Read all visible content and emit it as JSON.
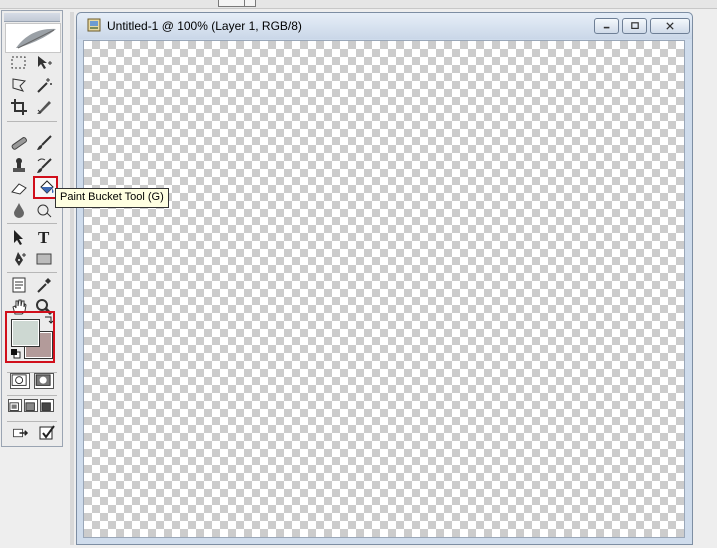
{
  "document": {
    "title": "Untitled-1 @ 100% (Layer 1, RGB/8)"
  },
  "tooltip": {
    "text": "Paint Bucket Tool (G)"
  },
  "toolbox": {
    "selected_tool": "paint-bucket",
    "foreground_color": "#cdd8d2",
    "background_color": "#b39b9a",
    "tools": [
      "marquee",
      "move",
      "lasso",
      "magic-wand",
      "crop",
      "slice",
      "healing-brush",
      "brush",
      "clone-stamp",
      "history-brush",
      "eraser",
      "paint-bucket",
      "blur",
      "dodge",
      "path-selection",
      "type",
      "pen",
      "shape",
      "notes",
      "eyedropper",
      "hand",
      "zoom"
    ]
  },
  "colors": {
    "selection_highlight": "#d10f1b",
    "tooltip_bg": "#ffffe1"
  }
}
